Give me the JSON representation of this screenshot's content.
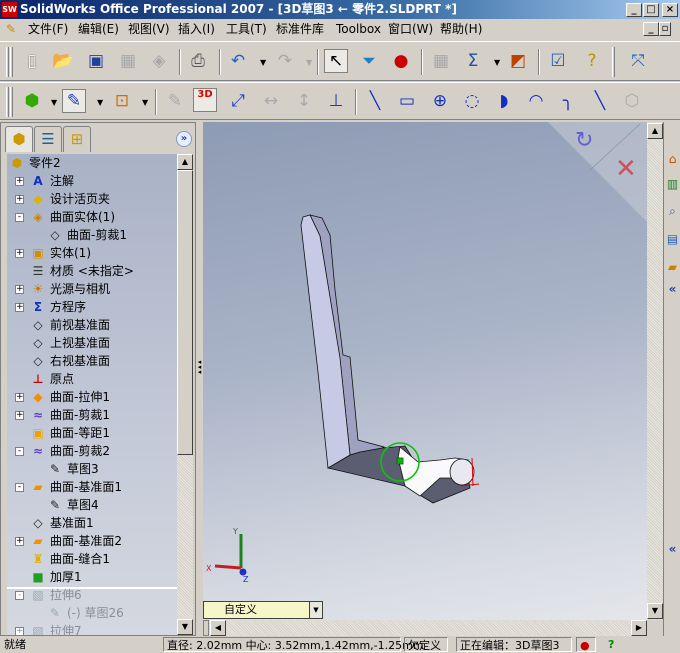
{
  "window": {
    "title": "SolidWorks Office Professional 2007 - [3D草图3 ← 零件2.SLDPRT *]",
    "app_icon": "SW",
    "controls": [
      "_",
      "□",
      "×"
    ],
    "doc_controls": [
      "_",
      "▫",
      "×"
    ]
  },
  "menu": [
    "文件(F)",
    "编辑(E)",
    "视图(V)",
    "插入(I)",
    "工具(T)",
    "标准件库",
    "Toolbox",
    "窗口(W)",
    "帮助(H)"
  ],
  "toolbar1": [
    "new-document",
    "open",
    "save",
    "make-drawing",
    "make-assembly",
    "print",
    "undo",
    "redo",
    "select",
    "selection-filter",
    "rebuild",
    "options-grid",
    "measure",
    "display-analysis",
    "task-list",
    "help",
    "sketch-launch"
  ],
  "toolbar2": [
    "features",
    "sketch",
    "smart-dimension-group",
    "edit-sketch",
    "3d-sketch",
    "smart-dimension",
    "horizontal-dim",
    "vertical-dim",
    "display-relations",
    "line",
    "rectangle",
    "circle",
    "perimeter-circle",
    "centerpoint-arc",
    "3-point-arc",
    "sketch-fillet",
    "chamfer",
    "polygon"
  ],
  "toolbar2_3d_label": "3D",
  "panel_tabs": [
    "featuremanager",
    "propertymanager",
    "configurationmanager"
  ],
  "tree": [
    {
      "label": "零件2",
      "level": 0,
      "icon": "part-icon"
    },
    {
      "label": "注解",
      "level": 1,
      "exp": "+",
      "icon": "annotations-icon"
    },
    {
      "label": "设计活页夹",
      "level": 1,
      "exp": "+",
      "icon": "design-binder-icon"
    },
    {
      "label": "曲面实体(1)",
      "level": 1,
      "exp": "-",
      "icon": "surface-bodies-icon"
    },
    {
      "label": "曲面-剪裁1",
      "level": 2,
      "icon": "surface-body-icon"
    },
    {
      "label": "实体(1)",
      "level": 1,
      "exp": "+",
      "icon": "solid-bodies-icon"
    },
    {
      "label": "材质 <未指定>",
      "level": 1,
      "icon": "material-icon"
    },
    {
      "label": "光源与相机",
      "level": 1,
      "exp": "+",
      "icon": "lights-icon"
    },
    {
      "label": "方程序",
      "level": 1,
      "exp": "+",
      "icon": "equations-icon"
    },
    {
      "label": "前视基准面",
      "level": 1,
      "icon": "plane-icon"
    },
    {
      "label": "上视基准面",
      "level": 1,
      "icon": "plane-icon"
    },
    {
      "label": "右视基准面",
      "level": 1,
      "icon": "plane-icon"
    },
    {
      "label": "原点",
      "level": 1,
      "icon": "origin-icon"
    },
    {
      "label": "曲面-拉伸1",
      "level": 1,
      "exp": "+",
      "icon": "surface-extrude-icon"
    },
    {
      "label": "曲面-剪裁1",
      "level": 1,
      "exp": "+",
      "icon": "surface-trim-icon"
    },
    {
      "label": "曲面-等距1",
      "level": 1,
      "icon": "surface-offset-icon"
    },
    {
      "label": "曲面-剪裁2",
      "level": 1,
      "exp": "-",
      "icon": "surface-trim-icon"
    },
    {
      "label": "草图3",
      "level": 2,
      "icon": "sketch-icon"
    },
    {
      "label": "曲面-基准面1",
      "level": 1,
      "exp": "-",
      "icon": "planar-surface-icon"
    },
    {
      "label": "草图4",
      "level": 2,
      "icon": "sketch-icon"
    },
    {
      "label": "基准面1",
      "level": 1,
      "icon": "plane-icon"
    },
    {
      "label": "曲面-基准面2",
      "level": 1,
      "exp": "+",
      "icon": "planar-surface-icon"
    },
    {
      "label": "曲面-缝合1",
      "level": 1,
      "icon": "knit-icon"
    },
    {
      "label": "加厚1",
      "level": 1,
      "icon": "thicken-icon"
    },
    {
      "label": "拉伸6",
      "level": 1,
      "exp": "-",
      "icon": "extrude-icon",
      "suppressed": true
    },
    {
      "label": "(-) 草图26",
      "level": 2,
      "icon": "sketch-icon",
      "suppressed": true
    },
    {
      "label": "拉伸7",
      "level": 1,
      "exp": "+",
      "icon": "extrude-icon",
      "suppressed": true
    }
  ],
  "view_orientation": {
    "selected": "自定义"
  },
  "triad": {
    "x": "X",
    "y": "Y",
    "z": "Z"
  },
  "confirmation_corner": [
    "exit-sketch",
    "cancel"
  ],
  "status": {
    "ready": "就绪",
    "measure": "直径: 2.02mm  中心: 3.52mm,1.42mm,-1.25mm",
    "constraint": "欠定义",
    "editing": "正在编辑：3D草图3"
  },
  "taskpane": [
    "home",
    "design-library",
    "file-explorer",
    "view-palette",
    "recover",
    "collapse"
  ],
  "colors": {
    "title_start": "#0a246a",
    "highlight": "#00c000",
    "origin": "#e00000"
  }
}
